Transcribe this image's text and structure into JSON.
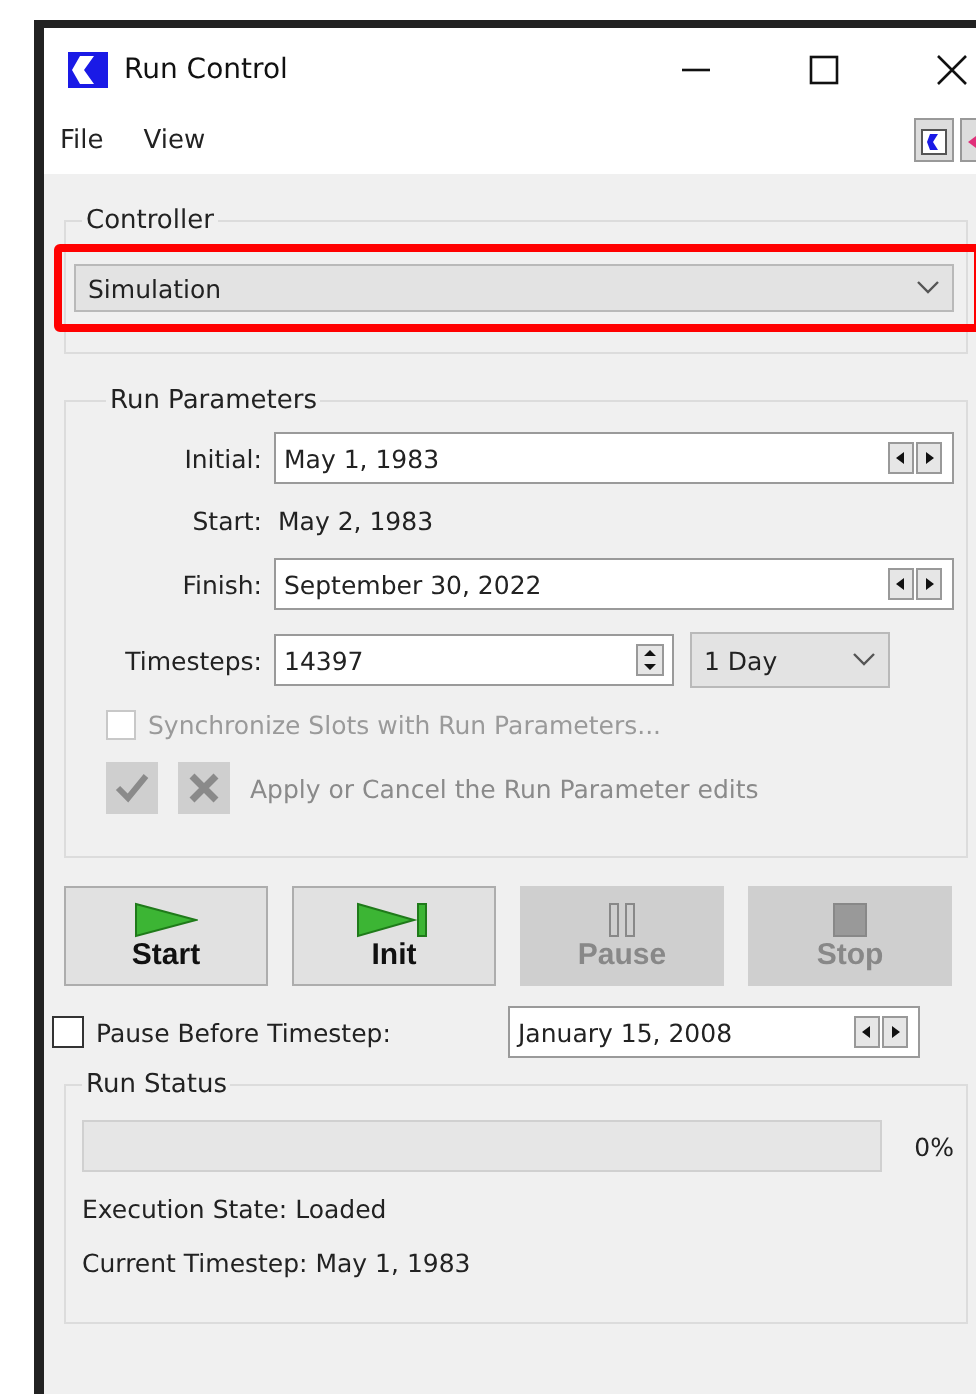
{
  "window": {
    "title": "Run Control"
  },
  "menu": [
    {
      "label": "File"
    },
    {
      "label": "View"
    }
  ],
  "controller": {
    "legend": "Controller",
    "value": "Simulation",
    "highlighted": true
  },
  "run_parameters": {
    "legend": "Run Parameters",
    "initial": {
      "label": "Initial:",
      "value": "May 1, 1983"
    },
    "start": {
      "label": "Start:",
      "value": "May 2, 1983"
    },
    "finish": {
      "label": "Finish:",
      "value": "September 30, 2022"
    },
    "timesteps": {
      "label": "Timesteps:",
      "value": "14397",
      "unit": "1 Day"
    },
    "synchronize": {
      "label": "Synchronize Slots with Run Parameters...",
      "checked": false,
      "disabled": true
    },
    "apply_note": "Apply or Cancel the Run Parameter edits"
  },
  "buttons": [
    {
      "label": "Start",
      "kind": "start",
      "disabled": false
    },
    {
      "label": "Init",
      "kind": "init",
      "disabled": false
    },
    {
      "label": "Pause",
      "kind": "pause",
      "disabled": true
    },
    {
      "label": "Stop",
      "kind": "stop",
      "disabled": true
    }
  ],
  "pause_before": {
    "label": "Pause Before Timestep:",
    "checked": false,
    "value": "January 15, 2008"
  },
  "run_status": {
    "legend": "Run Status",
    "level": 0,
    "reading": "0%",
    "execution_state": "Execution State:  Loaded",
    "current_timestep": "Current Timestep:  May 1, 1983"
  }
}
